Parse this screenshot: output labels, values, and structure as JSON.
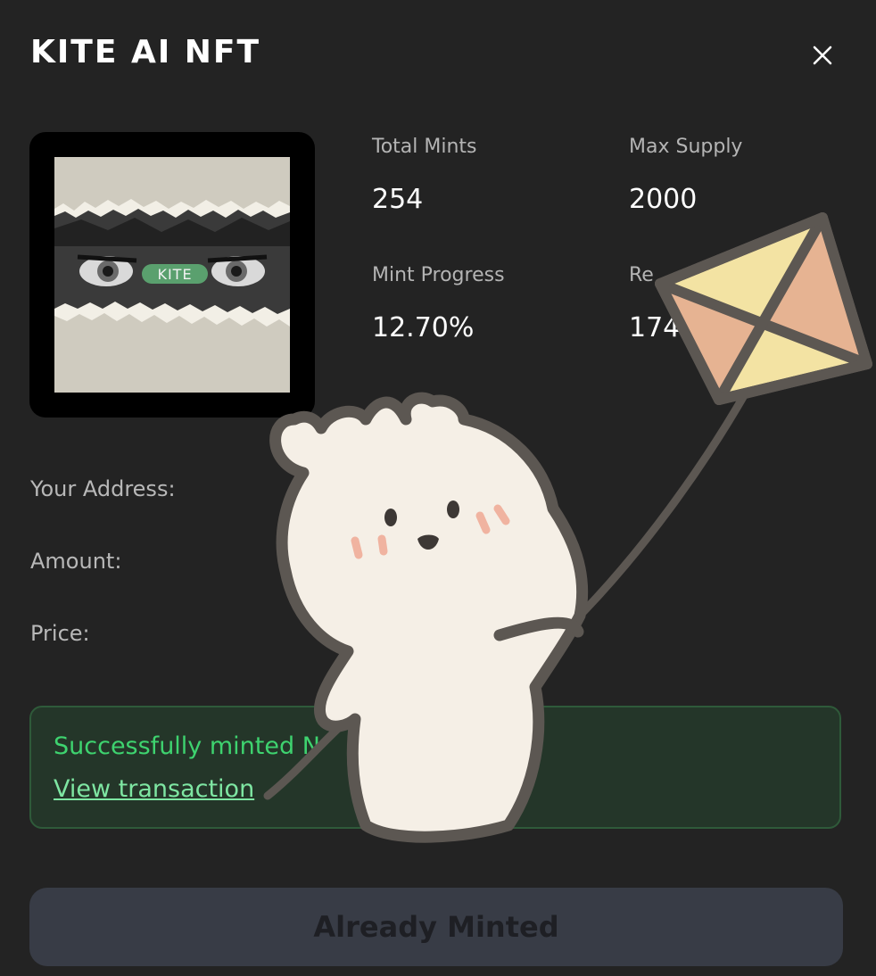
{
  "header": {
    "title": "KITE AI NFT",
    "close_icon": "close-icon"
  },
  "nft": {
    "badge_text": "KITE",
    "image_icon": "nft-artwork"
  },
  "stats": {
    "total_mints_label": "Total Mints",
    "total_mints_value": "254",
    "max_supply_label": "Max Supply",
    "max_supply_value": "2000",
    "mint_progress_label": "Mint Progress",
    "mint_progress_value": "12.70%",
    "remaining_label_partial": "Re",
    "remaining_value_partial": "174"
  },
  "form": {
    "address_label": "Your Address:",
    "amount_label": "Amount:",
    "price_label": "Price:"
  },
  "status": {
    "success_text": "Successfully minted N",
    "view_link": "View transaction"
  },
  "actions": {
    "mint_button": "Already Minted"
  },
  "sticker": {
    "icon": "bunny-flying-kite-sticker"
  },
  "colors": {
    "background": "#232323",
    "success_text": "#3ed36f",
    "success_bg": "#243629",
    "success_border": "#2f5a3a",
    "button_bg": "#383c46",
    "kite_yellow": "#f3e3a3",
    "kite_orange": "#e6b392",
    "bunny_body": "#f5efe6",
    "outline": "#5c5752"
  }
}
